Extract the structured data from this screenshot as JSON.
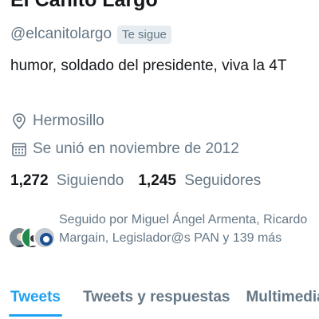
{
  "profile": {
    "display_name": "El Canito Largo",
    "handle": "@elcanitolargo",
    "follows_you_badge": "Te sigue",
    "bio": "humor, soldado del presidente, viva la 4T",
    "location": "Hermosillo",
    "joined": "Se unió en noviembre de 2012"
  },
  "stats": {
    "following_count": "1,272",
    "following_label": "Siguiendo",
    "followers_count": "1,245",
    "followers_label": "Seguidores"
  },
  "followed_by": {
    "text": "Seguido por Miguel Ángel Armenta, Ricardo Margain, Legislador@s PAN y 139 más"
  },
  "tabs": [
    {
      "label": "Tweets",
      "active": true
    },
    {
      "label": "Tweets y respuestas",
      "active": false
    },
    {
      "label": "Multimedia",
      "active": false
    }
  ],
  "icons": {
    "location": "location-pin-icon",
    "joined": "calendar-icon"
  },
  "colors": {
    "accent": "#1da1f2",
    "secondary_text": "#657786",
    "primary_text": "#14171a",
    "badge_background": "#e6ecf0"
  }
}
